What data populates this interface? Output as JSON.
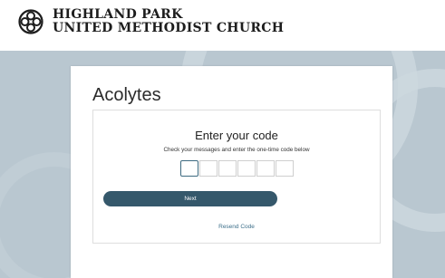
{
  "header": {
    "org_line1": "HIGHLAND PARK",
    "org_line2": "UNITED METHODIST CHURCH",
    "logo_icon": "church-cross-icon"
  },
  "main": {
    "title": "Acolytes",
    "card_title": "Enter your code",
    "instructions": "Check your messages and enter the one-time code below",
    "code_digits": [
      "",
      "",
      "",
      "",
      "",
      ""
    ],
    "next_label": "Next",
    "resend_label": "Resend Code"
  },
  "colors": {
    "background": "#b9c7d0",
    "button": "#35586b",
    "link": "#3d6f8a",
    "active_box": "#3d6a80"
  }
}
